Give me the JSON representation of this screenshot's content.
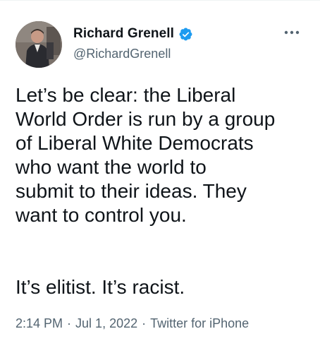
{
  "tweet": {
    "author": {
      "display_name": "Richard Grenell",
      "handle": "@RichardGrenell",
      "verified": true,
      "avatar_icon": "profile-photo"
    },
    "more_icon": "more-horizontal-icon",
    "text_line1": "Let’s be clear: the Liberal\nWorld Order is run by a group\nof Liberal White Democrats\nwho want the world to\nsubmit to their ideas. They\nwant to control you.",
    "text_line2": "It’s elitist. It’s racist.",
    "time": "2:14 PM",
    "date": "Jul 1, 2022",
    "source": "Twitter for iPhone",
    "separator": "·"
  },
  "colors": {
    "text_primary": "#0f1419",
    "text_secondary": "#536471",
    "verified_blue": "#1d9bf0",
    "background": "#ffffff"
  }
}
